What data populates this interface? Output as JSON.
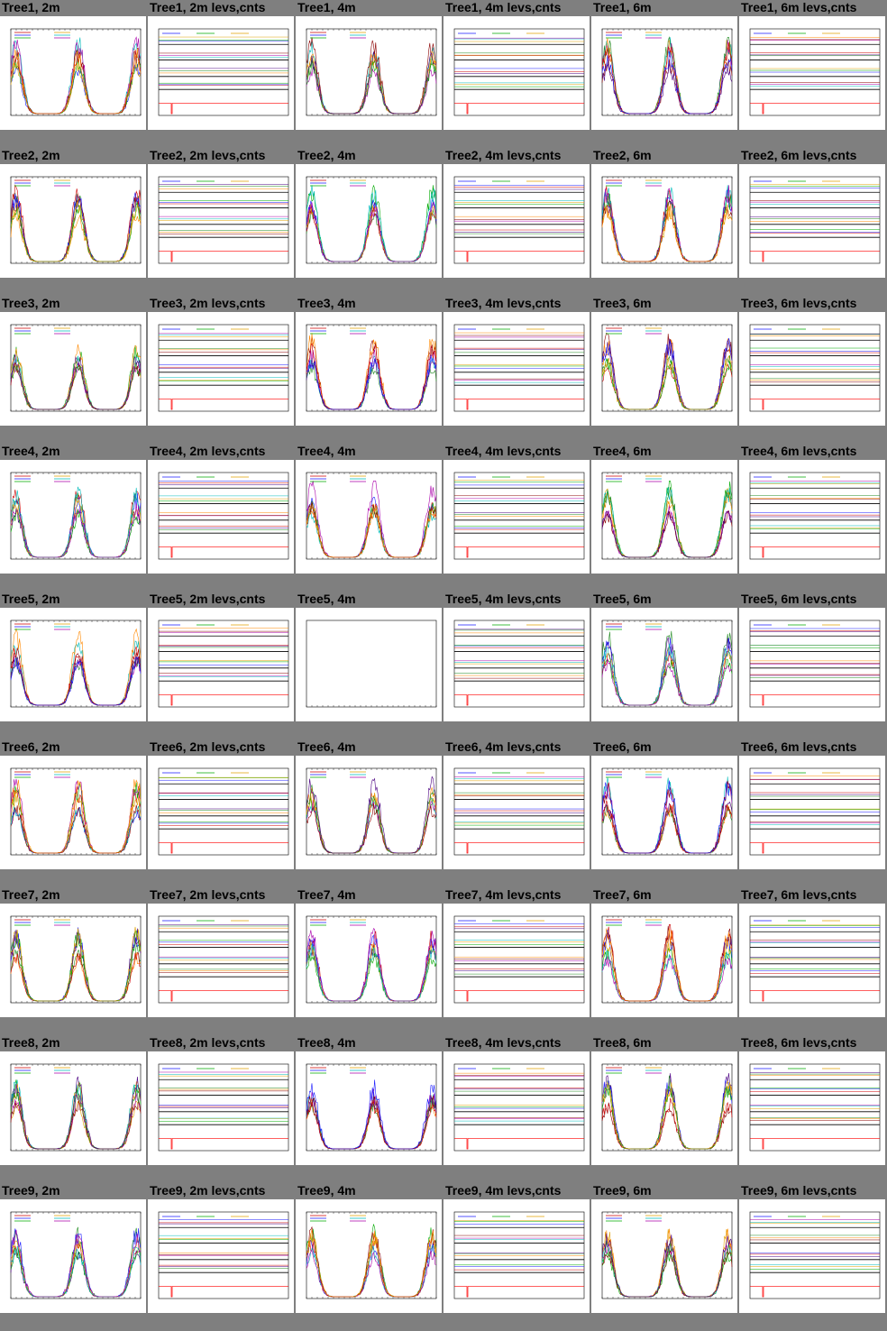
{
  "gallery": {
    "columns": [
      "2m",
      "2m levs,cnts",
      "4m",
      "4m levs,cnts",
      "6m",
      "6m levs,cnts"
    ],
    "panels": [
      {
        "title": "Tree1, 2m",
        "kind": "timeseries"
      },
      {
        "title": "Tree1, 2m levs,cnts",
        "kind": "levels"
      },
      {
        "title": "Tree1, 4m",
        "kind": "timeseries"
      },
      {
        "title": "Tree1, 4m levs,cnts",
        "kind": "levels"
      },
      {
        "title": "Tree1, 6m",
        "kind": "timeseries"
      },
      {
        "title": "Tree1, 6m levs,cnts",
        "kind": "levels"
      },
      {
        "title": "Tree2, 2m",
        "kind": "timeseries"
      },
      {
        "title": "Tree2, 2m levs,cnts",
        "kind": "levels"
      },
      {
        "title": "Tree2, 4m",
        "kind": "timeseries"
      },
      {
        "title": "Tree2, 4m levs,cnts",
        "kind": "levels"
      },
      {
        "title": "Tree2, 6m",
        "kind": "timeseries"
      },
      {
        "title": "Tree2, 6m levs,cnts",
        "kind": "levels"
      },
      {
        "title": "Tree3, 2m",
        "kind": "timeseries"
      },
      {
        "title": "Tree3, 2m levs,cnts",
        "kind": "levels"
      },
      {
        "title": "Tree3, 4m",
        "kind": "timeseries"
      },
      {
        "title": "Tree3, 4m levs,cnts",
        "kind": "levels"
      },
      {
        "title": "Tree3, 6m",
        "kind": "timeseries"
      },
      {
        "title": "Tree3, 6m levs,cnts",
        "kind": "levels"
      },
      {
        "title": "Tree4, 2m",
        "kind": "timeseries"
      },
      {
        "title": "Tree4, 2m levs,cnts",
        "kind": "levels"
      },
      {
        "title": "Tree4, 4m",
        "kind": "timeseries"
      },
      {
        "title": "Tree4, 4m levs,cnts",
        "kind": "levels"
      },
      {
        "title": "Tree4, 6m",
        "kind": "timeseries"
      },
      {
        "title": "Tree4, 6m levs,cnts",
        "kind": "levels"
      },
      {
        "title": "Tree5, 2m",
        "kind": "timeseries"
      },
      {
        "title": "Tree5, 2m levs,cnts",
        "kind": "levels"
      },
      {
        "title": "Tree5, 4m",
        "kind": "empty"
      },
      {
        "title": "Tree5, 4m levs,cnts",
        "kind": "levels"
      },
      {
        "title": "Tree5, 6m",
        "kind": "timeseries"
      },
      {
        "title": "Tree5, 6m levs,cnts",
        "kind": "levels"
      },
      {
        "title": "Tree6, 2m",
        "kind": "timeseries"
      },
      {
        "title": "Tree6, 2m levs,cnts",
        "kind": "levels"
      },
      {
        "title": "Tree6, 4m",
        "kind": "timeseries"
      },
      {
        "title": "Tree6, 4m levs,cnts",
        "kind": "levels"
      },
      {
        "title": "Tree6, 6m",
        "kind": "timeseries"
      },
      {
        "title": "Tree6, 6m levs,cnts",
        "kind": "levels"
      },
      {
        "title": "Tree7, 2m",
        "kind": "timeseries"
      },
      {
        "title": "Tree7, 2m levs,cnts",
        "kind": "levels"
      },
      {
        "title": "Tree7, 4m",
        "kind": "timeseries"
      },
      {
        "title": "Tree7, 4m levs,cnts",
        "kind": "levels"
      },
      {
        "title": "Tree7, 6m",
        "kind": "timeseries"
      },
      {
        "title": "Tree7, 6m levs,cnts",
        "kind": "levels"
      },
      {
        "title": "Tree8, 2m",
        "kind": "timeseries"
      },
      {
        "title": "Tree8, 2m levs,cnts",
        "kind": "levels"
      },
      {
        "title": "Tree8, 4m",
        "kind": "timeseries"
      },
      {
        "title": "Tree8, 4m levs,cnts",
        "kind": "levels"
      },
      {
        "title": "Tree8, 6m",
        "kind": "timeseries"
      },
      {
        "title": "Tree8, 6m levs,cnts",
        "kind": "levels"
      },
      {
        "title": "Tree9, 2m",
        "kind": "timeseries"
      },
      {
        "title": "Tree9, 2m levs,cnts",
        "kind": "levels"
      },
      {
        "title": "Tree9, 4m",
        "kind": "timeseries"
      },
      {
        "title": "Tree9, 4m levs,cnts",
        "kind": "levels"
      },
      {
        "title": "Tree9, 6m",
        "kind": "timeseries"
      },
      {
        "title": "Tree9, 6m levs,cnts",
        "kind": "levels"
      }
    ]
  },
  "colors": {
    "page_background": "#7f7f7f",
    "panel_background": "#ffffff",
    "series_palette": [
      "#cc0000",
      "#1a1aff",
      "#00aa00",
      "#e0a000",
      "#00bbbb",
      "#aa00aa",
      "#8b0000",
      "#ff8800",
      "#228b22",
      "#4b0082"
    ],
    "levels_marker": "#ff0000"
  }
}
